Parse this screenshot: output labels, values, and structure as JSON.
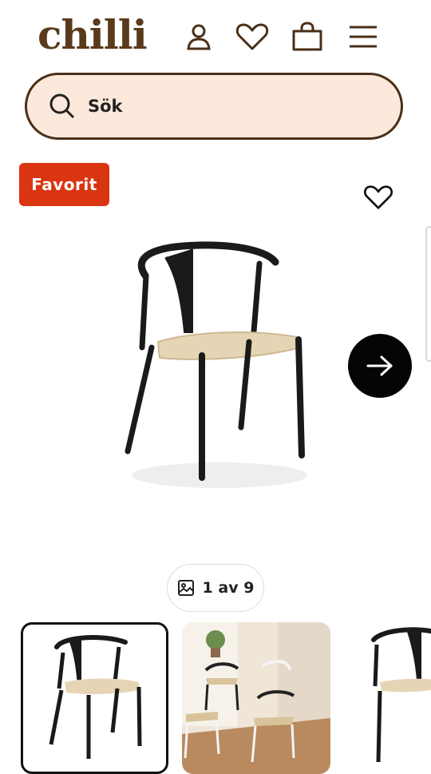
{
  "header": {
    "logo": "chilli",
    "icons": [
      "account-icon",
      "heart-icon",
      "bag-icon",
      "menu-icon"
    ]
  },
  "search": {
    "placeholder": "Sök"
  },
  "product": {
    "badge": "Favorit",
    "image_counter": "1 av 9"
  },
  "colors": {
    "brand_brown": "#5a3a1c",
    "search_bg": "#fde9dc",
    "badge_red": "#d93511",
    "arrow_button": "#050505"
  }
}
